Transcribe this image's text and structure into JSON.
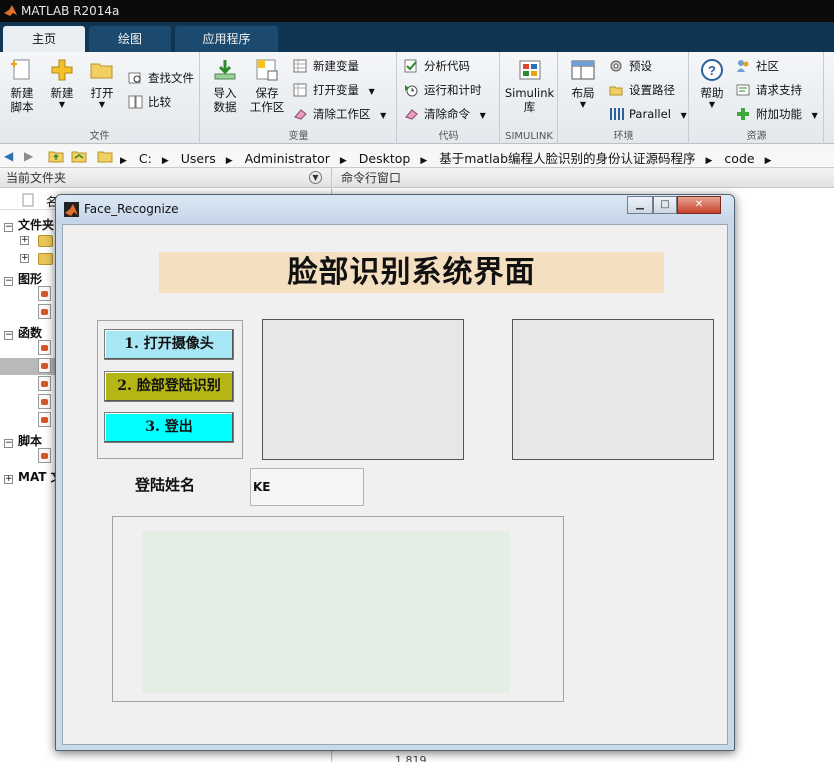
{
  "window": {
    "title": "MATLAB R2014a"
  },
  "tabs": [
    {
      "label": "主页",
      "active": true
    },
    {
      "label": "绘图",
      "active": false
    },
    {
      "label": "应用程序",
      "active": false
    }
  ],
  "ribbon": {
    "file_group": {
      "label": "文件",
      "new_script": "新建\n脚本",
      "new": "新建",
      "open": "打开",
      "find_files": "查找文件",
      "compare": "比较"
    },
    "variable_group": {
      "label": "变量",
      "import_data": "导入\n数据",
      "save_workspace": "保存\n工作区",
      "new_variable": "新建变量",
      "open_variable": "打开变量",
      "clear_workspace": "清除工作区"
    },
    "code_group": {
      "label": "代码",
      "analyze_code": "分析代码",
      "run_and_time": "运行和计时",
      "clear_commands": "清除命令"
    },
    "simulink_group": {
      "label": "SIMULINK",
      "simulink_library": "Simulink\n库"
    },
    "environment_group": {
      "label": "环境",
      "layout": "布局",
      "preferences": "预设",
      "set_path": "设置路径",
      "parallel": "Parallel"
    },
    "resources_group": {
      "label": "资源",
      "help": "帮助",
      "community": "社区",
      "request_support": "请求支持",
      "add_ons": "附加功能"
    }
  },
  "address_bar": {
    "crumbs": [
      "C:",
      "Users",
      "Administrator",
      "Desktop",
      "基于matlab编程人脸识别的身份认证源码程序",
      "code"
    ]
  },
  "current_folder_panel": {
    "title": "当前文件夹",
    "name_column": "名",
    "sections": [
      {
        "label": "文件夹"
      },
      {
        "label": "图形"
      },
      {
        "label": "函数"
      },
      {
        "label": "脚本"
      },
      {
        "label": "MAT 文"
      }
    ]
  },
  "command_window": {
    "title": "命令行窗口",
    "bottom_text": "1    819"
  },
  "figure": {
    "title": "Face_Recognize",
    "banner_title": "脸部识别系统界面",
    "buttons": {
      "open_camera": "1. 打开摄像头",
      "face_login": "2. 脸部登陆识别",
      "logout": "3. 登出"
    },
    "name_label": "登陆姓名",
    "name_value": "KE"
  },
  "colors": {
    "tabstrip": "#0f3553",
    "banner_bg": "#f5dfc1",
    "open_camera_btn": "#a6e6f5",
    "face_login_btn": "#b5b514",
    "logout_btn": "#00ffff",
    "list_bg": "#e3eee5"
  }
}
